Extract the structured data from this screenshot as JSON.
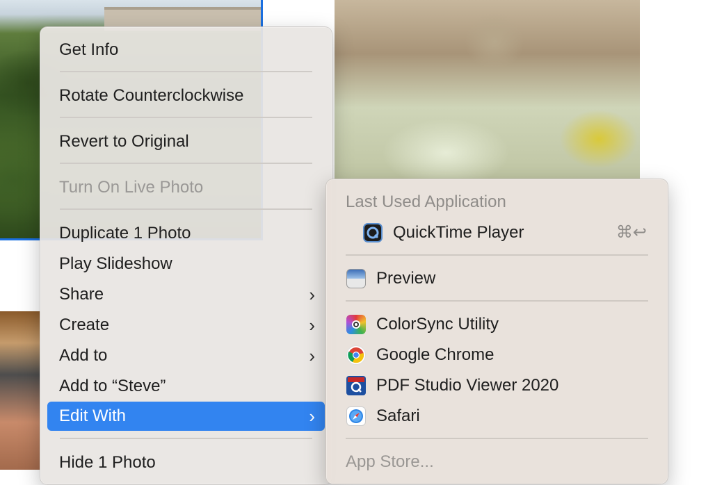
{
  "main_menu": {
    "items": [
      {
        "label": "Get Info"
      },
      {
        "label": "Rotate Counterclockwise"
      },
      {
        "label": "Revert to Original"
      },
      {
        "label": "Turn On Live Photo"
      },
      {
        "label": "Duplicate 1 Photo"
      },
      {
        "label": "Play Slideshow"
      },
      {
        "label": "Share"
      },
      {
        "label": "Create"
      },
      {
        "label": "Add to"
      },
      {
        "label": "Add to “Steve”"
      },
      {
        "label": "Edit With"
      },
      {
        "label": "Hide 1 Photo"
      }
    ],
    "chevron": "›"
  },
  "sub_menu": {
    "header": "Last Used Application",
    "last_used": {
      "label": "QuickTime Player",
      "icon": "quicktime-icon",
      "shortcut": "⌘↩"
    },
    "preview": {
      "label": "Preview",
      "icon": "preview-icon"
    },
    "apps": [
      {
        "label": "ColorSync Utility",
        "icon": "colorsync-icon"
      },
      {
        "label": "Google Chrome",
        "icon": "chrome-icon"
      },
      {
        "label": "PDF Studio Viewer 2020",
        "icon": "pdf-studio-icon"
      },
      {
        "label": "Safari",
        "icon": "safari-icon"
      }
    ],
    "app_store": "App Store..."
  },
  "colors": {
    "selection": "#3284f0",
    "photo_border": "#1a6fe0"
  }
}
